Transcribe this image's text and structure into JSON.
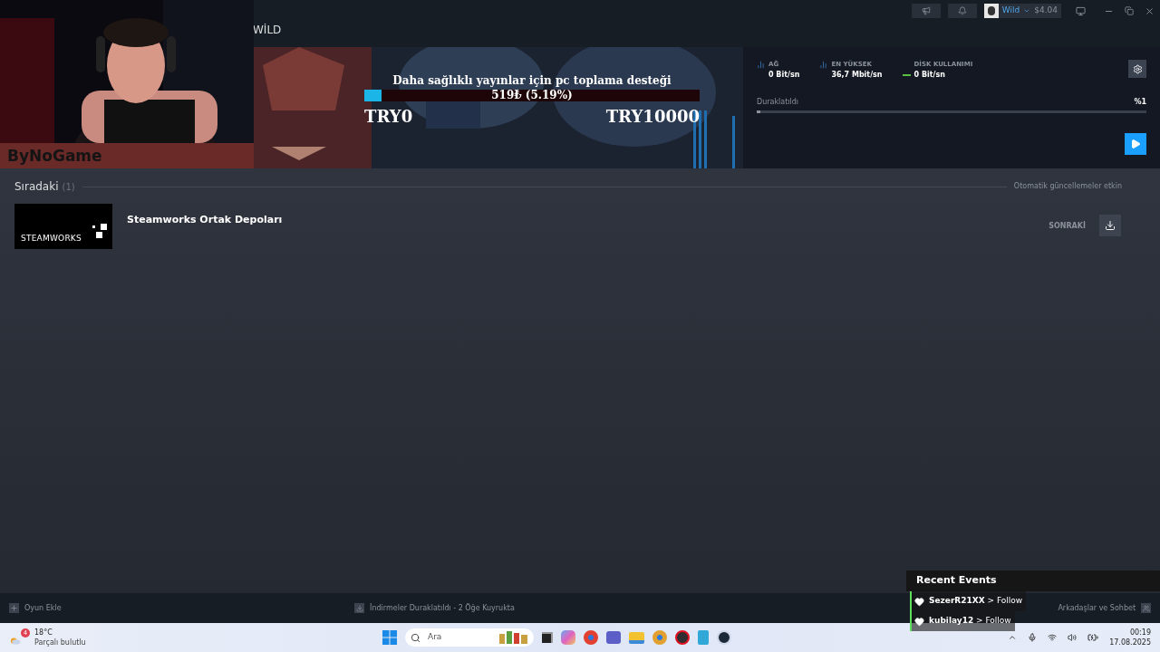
{
  "webcam": {
    "kind": "picture",
    "brand": "ByNoGame"
  },
  "profile_name": "WİLD",
  "account": {
    "name": "Wild",
    "balance": "$4.04"
  },
  "donation_goal": {
    "title": "Daha sağlıklı yayınlar için pc toplama desteği",
    "progress": "519₺ (5.19%)",
    "level": 0.0519,
    "min": "TRY0",
    "max": "TRY10000"
  },
  "stats": [
    {
      "label": "AĞ",
      "value": "0 Bit/sn",
      "kind": "bars"
    },
    {
      "label": "EN YÜKSEK",
      "value": "36,7 Mbit/sn",
      "kind": "bars"
    },
    {
      "label": "DİSK KULLANIMI",
      "value": "0 Bit/sn",
      "kind": "line"
    }
  ],
  "status": {
    "label": "Duraklatıldı",
    "percent": "%1",
    "level": 0.01
  },
  "queue": {
    "title": "Sıradaki",
    "count": "(1)",
    "auto_update": "Otomatik güncellemeler etkin",
    "items": [
      {
        "name": "Steamworks Ortak Depoları",
        "thumb": "STEAMWORKS",
        "action": "SONRAKİ"
      }
    ]
  },
  "footer": {
    "add_game": "Oyun Ekle",
    "downloads": "İndirmeler Duraklatıldı - 2 Öğe Kuyrukta",
    "friends": "Arkadaşlar ve Sohbet"
  },
  "recent_events": {
    "title": "Recent Events",
    "items": [
      {
        "user": "SezerR21XX",
        "action": "> Follow"
      },
      {
        "user": "kubilay12",
        "action": "> Follow"
      }
    ]
  },
  "taskbar": {
    "weather": {
      "temp": "18°C",
      "desc": "Parçalı bulutlu",
      "badge": "4"
    },
    "search_placeholder": "Ara",
    "time": "00:19",
    "date": "17.08.2025"
  }
}
